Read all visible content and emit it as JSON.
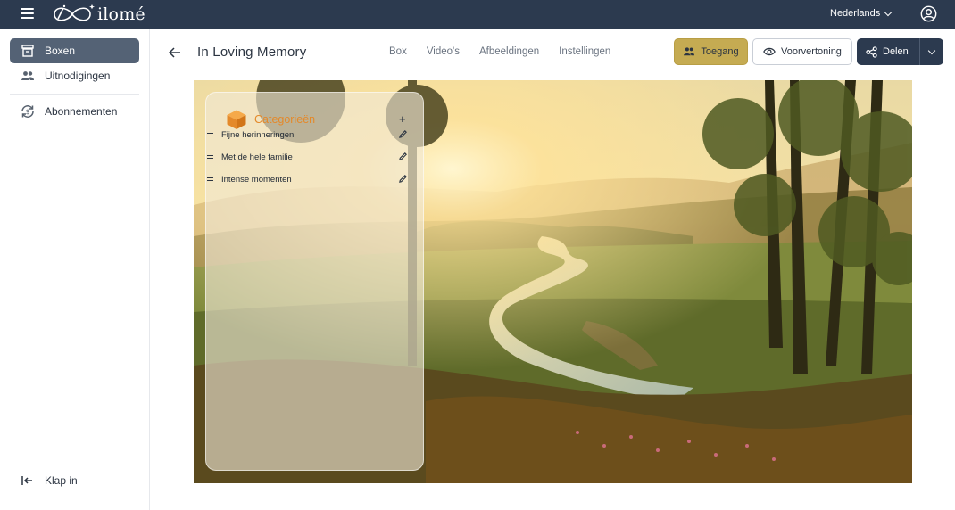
{
  "app": {
    "brand": "ilomé",
    "language": "Nederlands"
  },
  "sidebar": {
    "items": [
      {
        "label": "Boxen",
        "icon": "archive-icon",
        "active": true
      },
      {
        "label": "Uitnodigingen",
        "icon": "people-icon",
        "active": false
      },
      {
        "label": "Abonnementen",
        "icon": "subscription-icon",
        "active": false
      }
    ],
    "collapse_label": "Klap in"
  },
  "header": {
    "title": "In Loving Memory",
    "tabs": [
      "Box",
      "Video's",
      "Afbeeldingen",
      "Instellingen"
    ],
    "buttons": {
      "access": "Toegang",
      "preview": "Voorvertoning",
      "share": "Delen"
    }
  },
  "categories": {
    "title": "Categorieën",
    "add_symbol": "+",
    "items": [
      {
        "label": "Fijne herinneringen"
      },
      {
        "label": "Met de hele familie"
      },
      {
        "label": "Intense momenten"
      }
    ]
  },
  "colors": {
    "topbar": "#2c3a4f",
    "sidebar_active": "#546275",
    "accent_gold": "#c5ab52",
    "category_orange": "#e4892a"
  }
}
